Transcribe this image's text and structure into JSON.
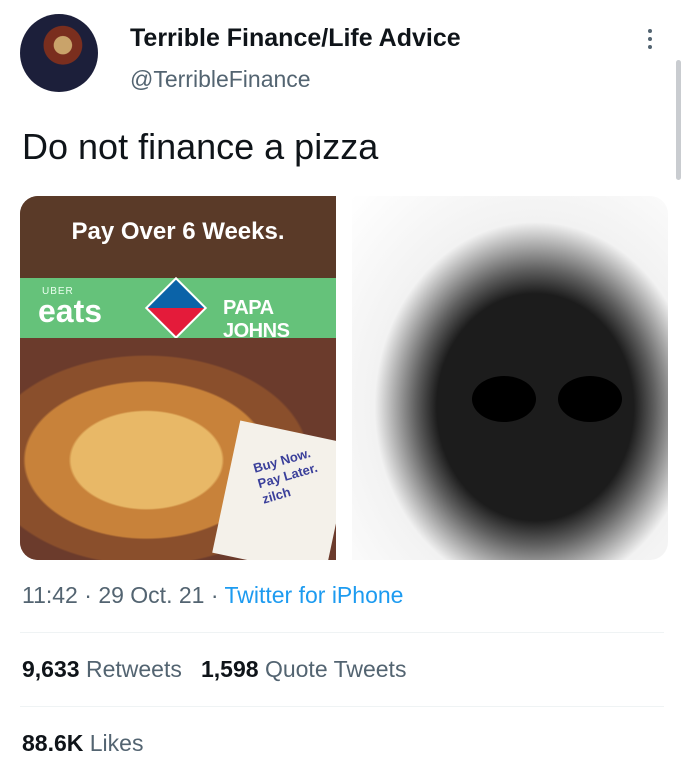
{
  "author": {
    "display_name": "Terrible Finance/Life Advice",
    "handle": "@TerribleFinance"
  },
  "tweet": {
    "text": "Do not finance a pizza"
  },
  "media": {
    "ad": {
      "headline": "Pay Over 6 Weeks.",
      "uber_small": "UBER",
      "uber_eats": "eats",
      "papa_johns": "PAPA JOHNS",
      "bnpl_line1": "Buy Now.",
      "bnpl_line2": "Pay Later.",
      "bnpl_brand": "zilch"
    }
  },
  "meta": {
    "time": "11:42",
    "sep1": " · ",
    "date": "29 Oct. 21",
    "sep2": " · ",
    "source": "Twitter for iPhone"
  },
  "stats": {
    "retweets_count": "9,633",
    "retweets_label": "Retweets",
    "quotes_count": "1,598",
    "quotes_label": "Quote Tweets",
    "likes_count": "88.6K",
    "likes_label": "Likes"
  },
  "colors": {
    "text": "#0f1419",
    "secondary": "#536471",
    "link": "#1d9bf0",
    "divider": "#eff3f4"
  }
}
